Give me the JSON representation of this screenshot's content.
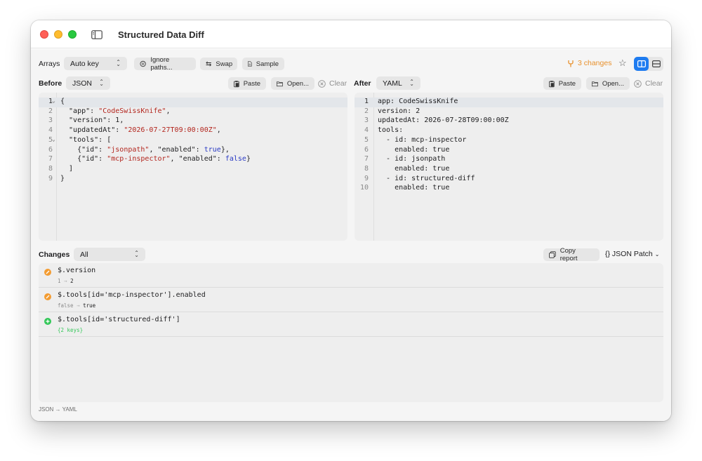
{
  "window": {
    "title": "Structured Data Diff"
  },
  "toolbar": {
    "arrays_label": "Arrays",
    "arrays_value": "Auto key",
    "ignore_paths": "Ignore paths...",
    "swap": "Swap",
    "sample": "Sample",
    "changes_count": "3 changes"
  },
  "before": {
    "label": "Before",
    "format": "JSON",
    "paste": "Paste",
    "open": "Open...",
    "clear": "Clear",
    "line_numbers": [
      "1",
      "2",
      "3",
      "4",
      "5",
      "6",
      "7",
      "8",
      "9"
    ]
  },
  "after": {
    "label": "After",
    "format": "YAML",
    "paste": "Paste",
    "open": "Open...",
    "clear": "Clear",
    "line_numbers": [
      "1",
      "2",
      "3",
      "4",
      "5",
      "6",
      "7",
      "8",
      "9",
      "10"
    ],
    "lines": [
      "app: CodeSwissKnife",
      "version: 2",
      "updatedAt: 2026-07-28T09:00:00Z",
      "tools:",
      "  - id: mcp-inspector",
      "    enabled: true",
      "  - id: jsonpath",
      "    enabled: true",
      "  - id: structured-diff",
      "    enabled: true"
    ]
  },
  "before_code": {
    "l1": "{",
    "l2_key": "  \"app\": ",
    "l2_val": "\"CodeSwissKnife\"",
    "l2_end": ",",
    "l3_key": "  \"version\": ",
    "l3_val": "1",
    "l3_end": ",",
    "l4_key": "  \"updatedAt\": ",
    "l4_val": "\"2026-07-27T09:00:00Z\"",
    "l4_end": ",",
    "l5": "  \"tools\": [",
    "l6_a": "    {\"id\": ",
    "l6_b": "\"jsonpath\"",
    "l6_c": ", \"enabled\": ",
    "l6_d": "true",
    "l6_e": "},",
    "l7_a": "    {\"id\": ",
    "l7_b": "\"mcp-inspector\"",
    "l7_c": ", \"enabled\": ",
    "l7_d": "false",
    "l7_e": "}",
    "l8": "  ]",
    "l9": "}"
  },
  "changes": {
    "label": "Changes",
    "filter": "All",
    "copy_report": "Copy report",
    "export_format": "{} JSON Patch",
    "items": [
      {
        "kind": "modified",
        "path": "$.version",
        "old": "1",
        "arrow": "→",
        "new": "2"
      },
      {
        "kind": "modified",
        "path": "$.tools[id='mcp-inspector'].enabled",
        "old": "false",
        "arrow": "→",
        "new": "true"
      },
      {
        "kind": "added",
        "path": "$.tools[id='structured-diff']",
        "detail": "{2 keys}"
      }
    ]
  },
  "footer": {
    "status": "JSON → YAML"
  },
  "colors": {
    "accent": "#1f7cf0",
    "changes": "#e8912d",
    "added": "#34c759",
    "modified": "#f39c32"
  },
  "icons": [
    "sidebar-icon",
    "ignore-icon",
    "swap-icon",
    "sample-icon",
    "changes-icon",
    "star-icon",
    "split-view-icon",
    "stacked-view-icon",
    "paste-icon",
    "folder-icon",
    "clear-icon",
    "copy-icon"
  ]
}
